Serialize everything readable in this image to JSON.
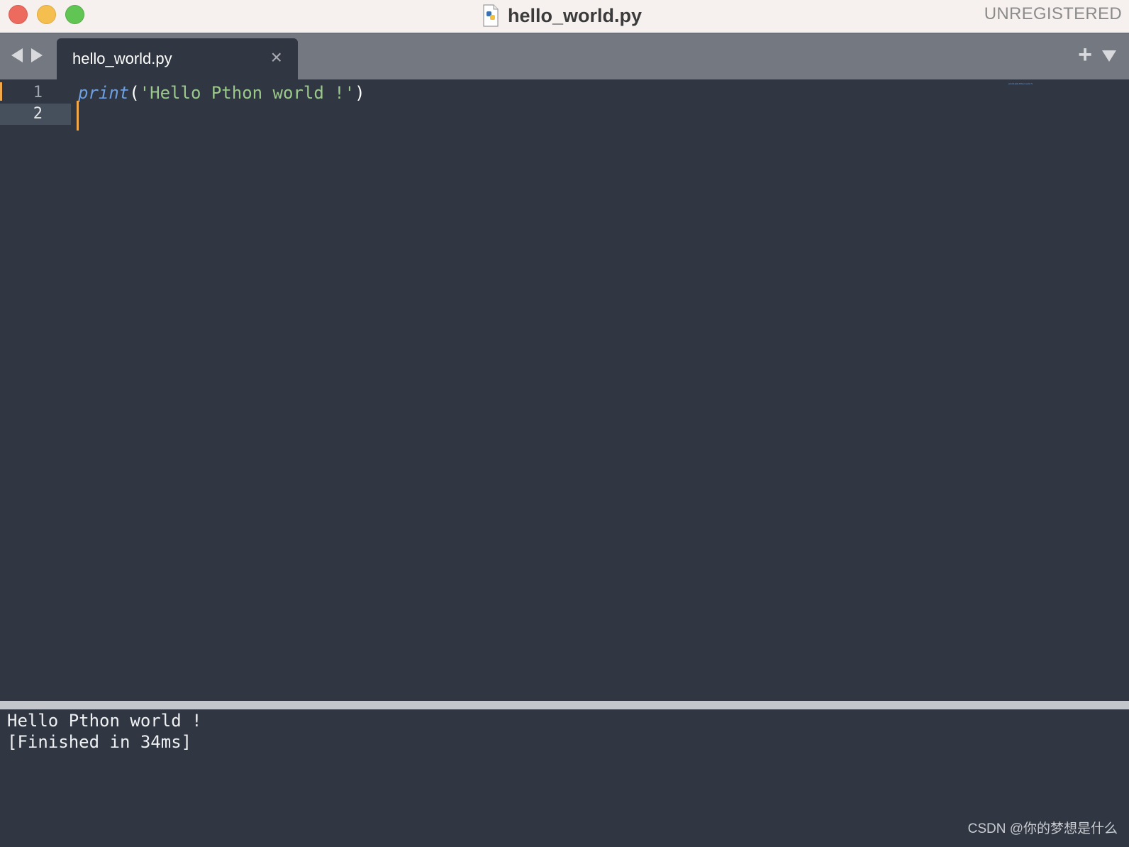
{
  "window": {
    "title": "hello_world.py",
    "license_status": "UNREGISTERED",
    "file_icon": "python-file-icon"
  },
  "tabs": [
    {
      "label": "hello_world.py",
      "active": true,
      "close_icon": "close-icon"
    }
  ],
  "tabbar": {
    "back_icon": "arrow-left-icon",
    "forward_icon": "arrow-right-icon",
    "new_tab_label": "+",
    "menu_icon": "chevron-down-icon"
  },
  "editor": {
    "lines": [
      {
        "number": "1",
        "keyword": "print",
        "open_paren": "(",
        "string": "'Hello Pthon world !'",
        "close_paren": ")"
      },
      {
        "number": "2",
        "text": ""
      }
    ],
    "minimap_text": "print('Hello Pthon world !')",
    "current_line": 2
  },
  "output": {
    "lines": [
      "Hello Pthon world !",
      "[Finished in 34ms]"
    ]
  },
  "watermark": "CSDN @你的梦想是什么",
  "colors": {
    "editor_bg": "#303742",
    "tabbar_bg": "#747981",
    "keyword": "#6e9fe0",
    "string": "#9ac98a",
    "cursor": "#f1a94a"
  }
}
